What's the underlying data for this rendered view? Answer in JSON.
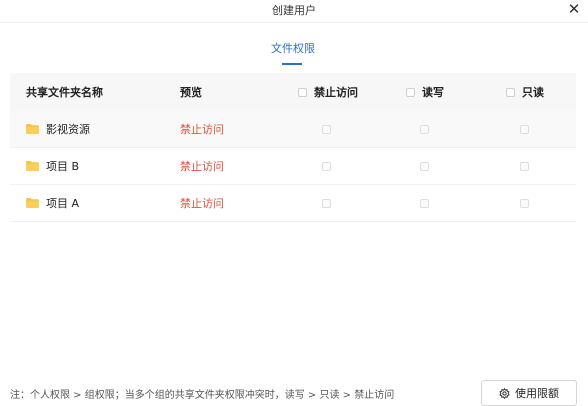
{
  "window": {
    "title": "创建用户",
    "close_glyph": "✕"
  },
  "tabs": [
    {
      "label": "文件权限",
      "active": true
    }
  ],
  "table": {
    "columns": {
      "name": "共享文件夹名称",
      "preview": "预览",
      "block": "禁止访问",
      "readwrite": "读写",
      "readonly": "只读"
    },
    "rows": [
      {
        "name": "影视资源",
        "preview": "禁止访问"
      },
      {
        "name": "项目 B",
        "preview": "禁止访问"
      },
      {
        "name": "项目 A",
        "preview": "禁止访问"
      }
    ]
  },
  "footer": {
    "note": "注：个人权限 > 组权限；当多个组的共享文件夹权限冲突时，读写 > 只读 > 禁止访问",
    "quota_button": "使用限额"
  },
  "colors": {
    "accent": "#2f6ecb",
    "deny": "#e0533d",
    "folder": "#f6c445"
  },
  "icons": {
    "close": "close-icon",
    "folder": "folder-icon",
    "gear": "gear-icon"
  }
}
